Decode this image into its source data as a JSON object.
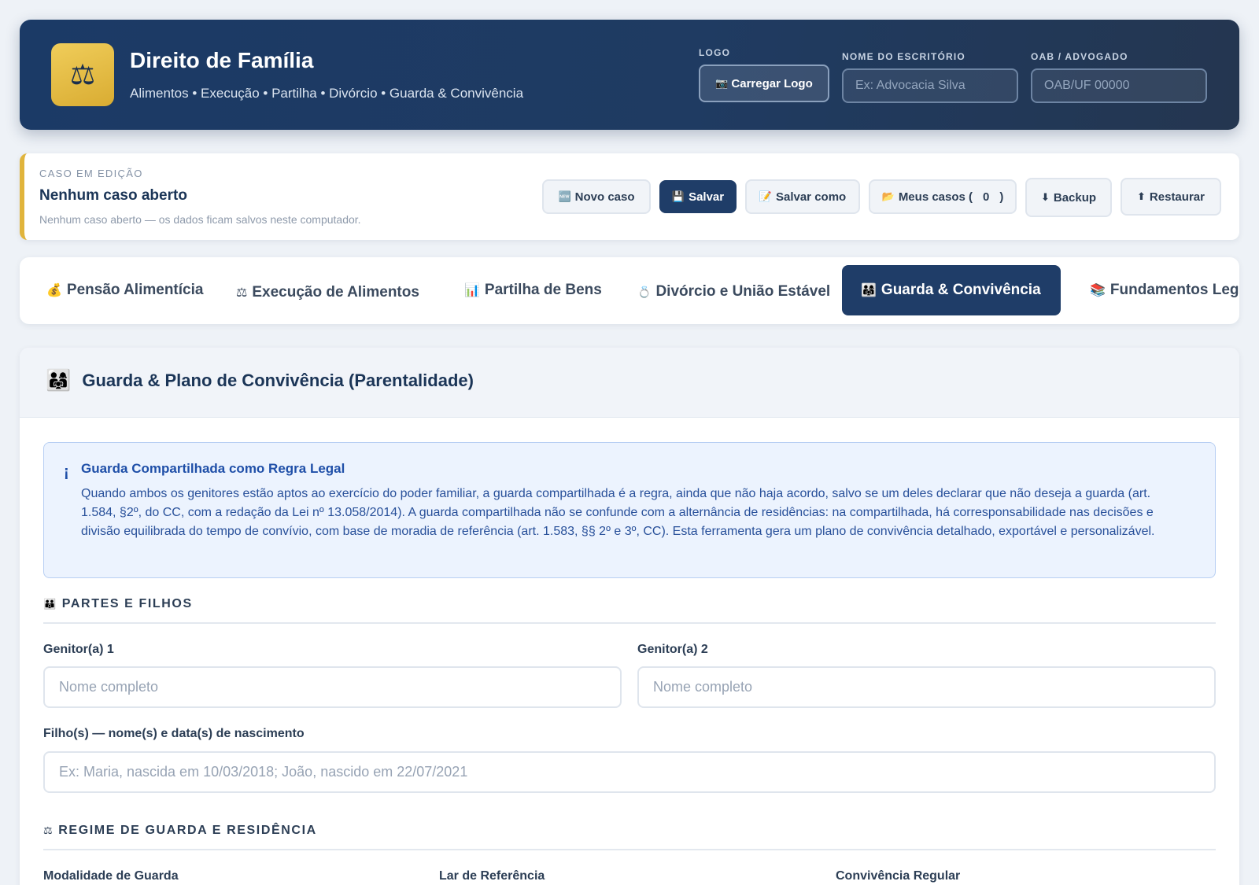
{
  "header": {
    "logo_icon": "⚖",
    "title": "Direito de Família",
    "subtitle": "Alimentos • Execução • Partilha • Divórcio • Guarda & Convivência",
    "logo_label": "LOGO",
    "upload_icon": "📷",
    "upload_label": "Carregar Logo",
    "office_label": "NOME DO ESCRITÓRIO",
    "office_placeholder": "Ex: Advocacia Silva",
    "oab_label": "OAB / ADVOGADO",
    "oab_placeholder": "OAB/UF 00000"
  },
  "case": {
    "label": "CASO EM EDIÇÃO",
    "title": "Nenhum caso aberto",
    "note": "Nenhum caso aberto — os dados ficam salvos neste computador.",
    "buttons": {
      "new": {
        "icon": "🆕",
        "label": "Novo caso"
      },
      "save": {
        "icon": "💾",
        "label": "Salvar"
      },
      "save_as": {
        "icon": "📝",
        "label": "Salvar como"
      },
      "my_cases": {
        "icon": "📂",
        "label": "Meus casos (",
        "count": "0",
        "suffix": ")"
      },
      "backup": {
        "icon": "⬇",
        "label": "Backup"
      },
      "restore": {
        "icon": "⬆",
        "label": "Restaurar"
      }
    }
  },
  "tabs": [
    {
      "icon": "💰",
      "label": "Pensão Alimentícia"
    },
    {
      "icon": "⚖",
      "label": "Execução de Alimentos"
    },
    {
      "icon": "📊",
      "label": "Partilha de Bens"
    },
    {
      "icon": "💍",
      "label": "Divórcio e União Estável"
    },
    {
      "icon": "👨‍👩‍👧",
      "label": "Guarda & Convivência",
      "active": true
    },
    {
      "icon": "📚",
      "label": "Fundamentos Legais"
    }
  ],
  "panel": {
    "icon": "👨‍👩‍👧",
    "title": "Guarda & Plano de Convivência (Parentalidade)",
    "info": {
      "icon": "¡",
      "title": "Guarda Compartilhada como Regra Legal",
      "text": "Quando ambos os genitores estão aptos ao exercício do poder familiar, a guarda compartilhada é a regra, ainda que não haja acordo, salvo se um deles declarar que não deseja a guarda (art. 1.584, §2º, do CC, com a redação da Lei nº 13.058/2014). A guarda compartilhada não se confunde com a alternância de residências: na compartilhada, há corresponsabilidade nas decisões e divisão equilibrada do tempo de convívio, com base de moradia de referência (art. 1.583, §§ 2º e 3º, CC). Esta ferramenta gera um plano de convivência detalhado, exportável e personalizável."
    },
    "section_parties": {
      "icon": "👪",
      "title": "PARTES E FILHOS"
    },
    "parent1": {
      "label": "Genitor(a) 1",
      "placeholder": "Nome completo"
    },
    "parent2": {
      "label": "Genitor(a) 2",
      "placeholder": "Nome completo"
    },
    "children": {
      "label": "Filho(s) — nome(s) e data(s) de nascimento",
      "placeholder": "Ex: Maria, nascida em 10/03/2018; João, nascido em 22/07/2021"
    },
    "section_regime": {
      "icon": "⚖",
      "title": "REGIME DE GUARDA E RESIDÊNCIA"
    },
    "custody_label": "Modalidade de Guarda",
    "home_label": "Lar de Referência",
    "visits_label": "Convivência Regular"
  },
  "colors": {
    "header_bg": "#1f3b62",
    "accent_gold": "#e0b43c",
    "primary": "#1f3d68",
    "info_blue": "#1f4fa8"
  }
}
